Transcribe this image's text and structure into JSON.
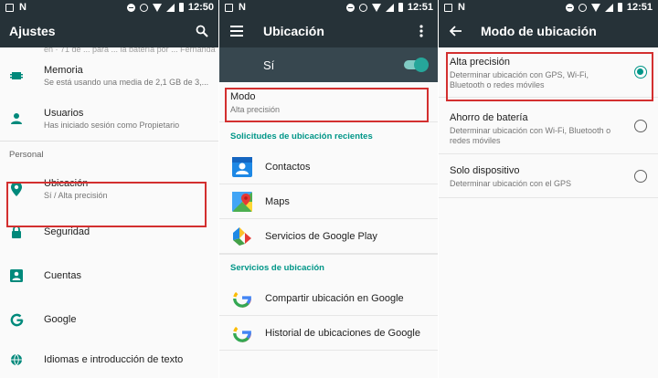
{
  "status_bar": {
    "screen1_time": "12:50",
    "screen2_time": "12:51",
    "screen3_time": "12:51",
    "icons": [
      "image-icon",
      "n-icon",
      "dnd-icon",
      "alarm-icon",
      "wifi-icon",
      "signal-icon",
      "battery-icon"
    ]
  },
  "screen1": {
    "title": "Ajustes",
    "clipped_text": "en · 71 de ... para ... la batería por ... Fernanda",
    "items": [
      {
        "label": "Memoria",
        "sub": "Se está usando una media de 2,1 GB de 3,...",
        "icon": "memory-icon"
      },
      {
        "label": "Usuarios",
        "sub": "Has iniciado sesión como Propietario",
        "icon": "person-icon"
      }
    ],
    "section": "Personal",
    "personal_items": [
      {
        "label": "Ubicación",
        "sub": "Sí / Alta precisión",
        "icon": "location-pin-icon"
      },
      {
        "label": "Seguridad",
        "sub": "",
        "icon": "lock-icon"
      },
      {
        "label": "Cuentas",
        "sub": "",
        "icon": "account-box-icon"
      },
      {
        "label": "Google",
        "sub": "",
        "icon": "google-g-icon"
      },
      {
        "label": "Idiomas e introducción de texto",
        "sub": "",
        "icon": "globe-icon"
      }
    ]
  },
  "screen2": {
    "title": "Ubicación",
    "master_label": "Sí",
    "mode_label": "Modo",
    "mode_value": "Alta precisión",
    "recent_header": "Solicitudes de ubicación recientes",
    "recent_apps": [
      {
        "label": "Contactos",
        "icon": "contacts-icon"
      },
      {
        "label": "Maps",
        "icon": "maps-icon"
      },
      {
        "label": "Servicios de Google Play",
        "icon": "play-services-icon"
      }
    ],
    "services_header": "Servicios de ubicación",
    "services": [
      {
        "label": "Compartir ubicación en Google",
        "icon": "google-g-icon"
      },
      {
        "label": "Historial de ubicaciones de Google",
        "icon": "google-g-icon"
      }
    ]
  },
  "screen3": {
    "title": "Modo de ubicación",
    "options": [
      {
        "label": "Alta precisión",
        "desc": "Determinar ubicación con GPS, Wi-Fi, Bluetooth o redes móviles",
        "selected": true
      },
      {
        "label": "Ahorro de batería",
        "desc": "Determinar ubicación con Wi-Fi, Bluetooth o redes móviles",
        "selected": false
      },
      {
        "label": "Solo dispositivo",
        "desc": "Determinar ubicación con el GPS",
        "selected": false
      }
    ]
  },
  "colors": {
    "appbar": "#263238",
    "master_bar": "#37474f",
    "accent": "#009688",
    "highlight": "#d32f2f"
  }
}
